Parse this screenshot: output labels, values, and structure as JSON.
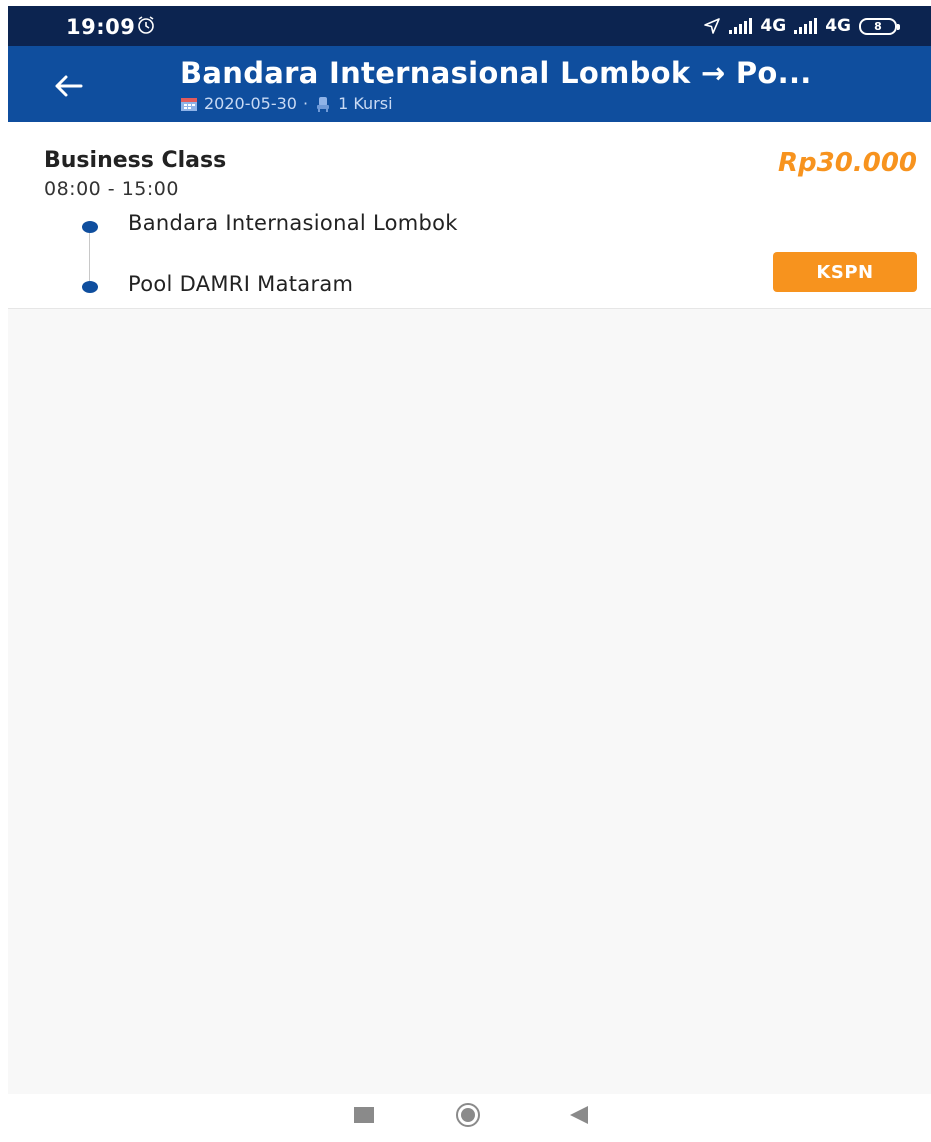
{
  "status_bar": {
    "time": "19:09",
    "network_1": "4G",
    "network_2": "4G",
    "battery": "8",
    "icons": [
      "alarm-icon",
      "location-icon",
      "signal-icon",
      "battery-icon"
    ]
  },
  "app_bar": {
    "title": "Bandara Internasional Lombok → Po...",
    "date": "2020-05-30",
    "separator": "·",
    "seats": "1 Kursi",
    "icons": [
      "back-arrow-icon",
      "calendar-icon",
      "seat-icon"
    ]
  },
  "trip": {
    "class_name": "Business Class",
    "time_range": "08:00 - 15:00",
    "price": "Rp30.000",
    "origin": "Bandara Internasional Lombok",
    "destination": "Pool DAMRI Mataram",
    "badge": "KSPN"
  },
  "navigation": {
    "icons": [
      "recents-icon",
      "home-icon",
      "back-icon"
    ]
  },
  "colors": {
    "status_bar_bg": "#0c2450",
    "app_bar_bg": "#0f4e9e",
    "accent_orange": "#f7931e",
    "background": "#f8f8f8"
  }
}
